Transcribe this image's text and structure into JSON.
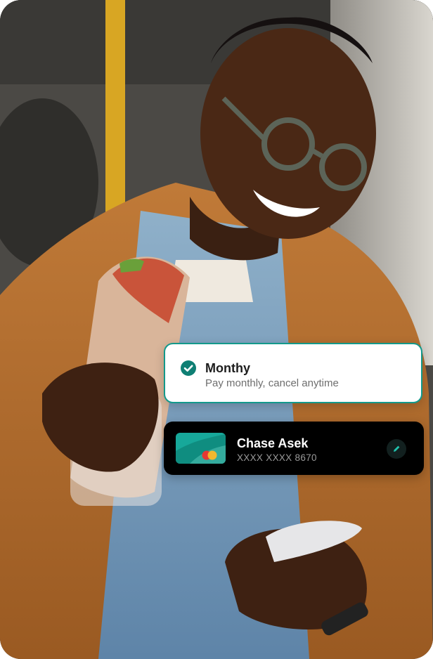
{
  "photo": {
    "subject": "smiling-man-holding-sandwich-and-phone"
  },
  "plan": {
    "title": "Monthy",
    "subtitle": "Pay monthly, cancel anytime",
    "selected": true,
    "accent_color": "#13998b",
    "icon": "check-circle-icon"
  },
  "payment_card": {
    "holder": "Chase Asek",
    "number": "XXXX XXXX 8670",
    "card_color": "#17a89a",
    "brand_icon": "mastercard-icon",
    "edit_icon": "pencil-icon",
    "background": "#000000"
  }
}
